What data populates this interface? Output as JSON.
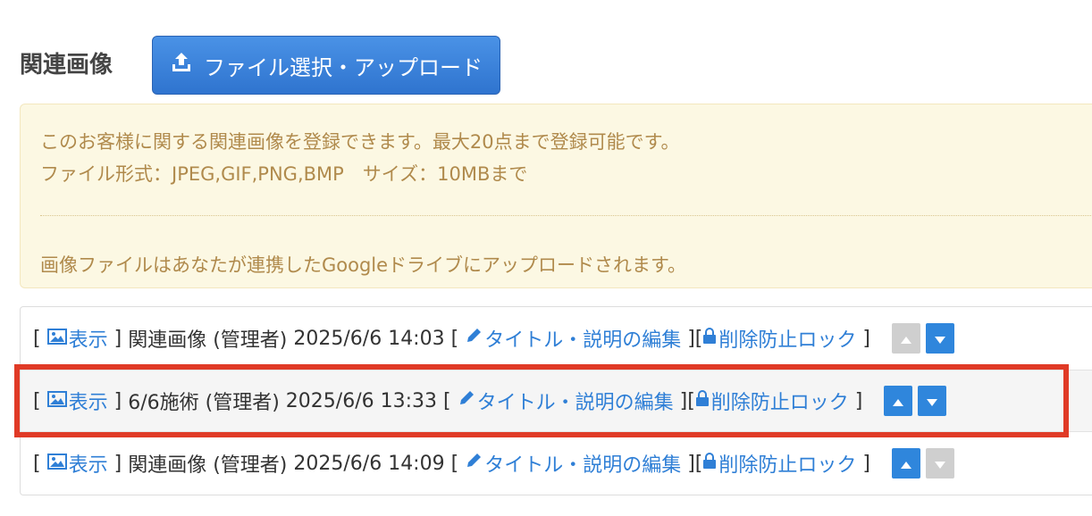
{
  "section": {
    "heading": "関連画像",
    "upload_button_label": "ファイル選択・アップロード"
  },
  "notice": {
    "line1": "このお客様に関する関連画像を登録できます。最大20点まで登録可能です。",
    "line2": "ファイル形式：JPEG,GIF,PNG,BMP　サイズ：10MBまで",
    "line3": "画像ファイルはあなたが連携したGoogleドライブにアップロードされます。"
  },
  "labels": {
    "open_bracket": "[",
    "close_bracket": "]",
    "close_open_bracket": "][",
    "view_link": "表示",
    "edit_link": "タイトル・説明の編集",
    "lock_link": "削除防止ロック"
  },
  "images": [
    {
      "title": "関連画像",
      "author": "(管理者)",
      "datetime": "2025/6/6 14:03",
      "up_enabled": false,
      "down_enabled": true
    },
    {
      "title": "6/6施術",
      "author": "(管理者)",
      "datetime": "2025/6/6 13:33",
      "up_enabled": true,
      "down_enabled": true
    },
    {
      "title": "関連画像",
      "author": "(管理者)",
      "datetime": "2025/6/6 14:09",
      "up_enabled": true,
      "down_enabled": false
    }
  ],
  "colors": {
    "link": "#2f7fd6",
    "button": "#2f86dc",
    "disabled": "#cfcfcf",
    "notice_bg": "#fcf8e3",
    "notice_text": "#b08a4c",
    "highlight": "#e03a26"
  },
  "icons": {
    "upload": "upload-icon",
    "image": "image-icon",
    "pencil": "pencil-icon",
    "lock": "lock-icon",
    "up": "arrow-up-icon",
    "down": "arrow-down-icon"
  }
}
